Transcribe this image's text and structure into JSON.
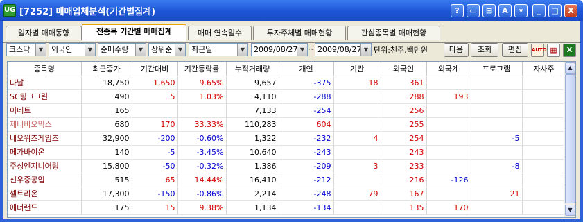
{
  "window": {
    "app_icon": "UG",
    "title": "[7252] 매매입체분석(기간별집계)",
    "buttons": [
      "?",
      "▭",
      "⊞",
      "A",
      "▾",
      "_",
      "□",
      "X"
    ]
  },
  "tabs": [
    {
      "label": "일자별 매매동향",
      "active": false
    },
    {
      "label": "전종목 기간별 매매집계",
      "active": true
    },
    {
      "label": "매매 연속일수",
      "active": false
    },
    {
      "label": "투자주체별 매매현황",
      "active": false
    },
    {
      "label": "관심종목별 매매현황",
      "active": false
    }
  ],
  "toolbar": {
    "market": "코스닥",
    "investor": "외국인",
    "sort_by": "순매수량",
    "rank": "상위순",
    "period": "최근일",
    "date_from": "2009/08/27",
    "tilde": "~",
    "date_to": "2009/08/27",
    "unit": "단위:천주,백만원",
    "next_label": "다음",
    "query_label": "조회",
    "edit_label": "편집",
    "auto_label": "AUTO"
  },
  "table": {
    "columns": [
      "종목명",
      "최근종가",
      "기간대비",
      "기간등락률",
      "누적거래량",
      "개인",
      "기관",
      "외국인",
      "외국계",
      "프로그램",
      "자사주"
    ],
    "rows": [
      [
        "다날",
        "18,750",
        "1,650",
        "9.65%",
        "9,657",
        "-375",
        "18",
        "361",
        "",
        "",
        ""
      ],
      [
        "SC팅크그린",
        "490",
        "5",
        "1.03%",
        "4,110",
        "-288",
        "",
        "288",
        "193",
        "",
        ""
      ],
      [
        "이네트",
        "165",
        "",
        "",
        "7,133",
        "-254",
        "",
        "256",
        "",
        "",
        ""
      ],
      [
        "제너비오믹스",
        "680",
        "170",
        "33.33%",
        "110,283",
        "604",
        "",
        "255",
        "",
        "",
        ""
      ],
      [
        "네오위즈게임즈",
        "32,900",
        "-200",
        "-0.60%",
        "1,322",
        "-232",
        "4",
        "254",
        "",
        "-5",
        ""
      ],
      [
        "메가바이온",
        "140",
        "-5",
        "-3.45%",
        "10,640",
        "-243",
        "",
        "243",
        "",
        "",
        ""
      ],
      [
        "주성엔지니어링",
        "15,800",
        "-50",
        "-0.32%",
        "1,386",
        "-209",
        "3",
        "233",
        "",
        "-8",
        ""
      ],
      [
        "선우중공업",
        "515",
        "65",
        "14.44%",
        "16,410",
        "-212",
        "",
        "216",
        "-126",
        "",
        ""
      ],
      [
        "셀트리온",
        "17,300",
        "-150",
        "-0.86%",
        "2,214",
        "-248",
        "79",
        "167",
        "",
        "21",
        ""
      ],
      [
        "에너랜드",
        "175",
        "15",
        "9.38%",
        "1,134",
        "-134",
        "",
        "135",
        "170",
        "",
        ""
      ]
    ]
  },
  "colors": {
    "title_bar": "#1d55d6",
    "positive": "#d40000",
    "negative": "#0000d0",
    "stock_name": "#800000",
    "upper_limit_name": "#c86060"
  }
}
